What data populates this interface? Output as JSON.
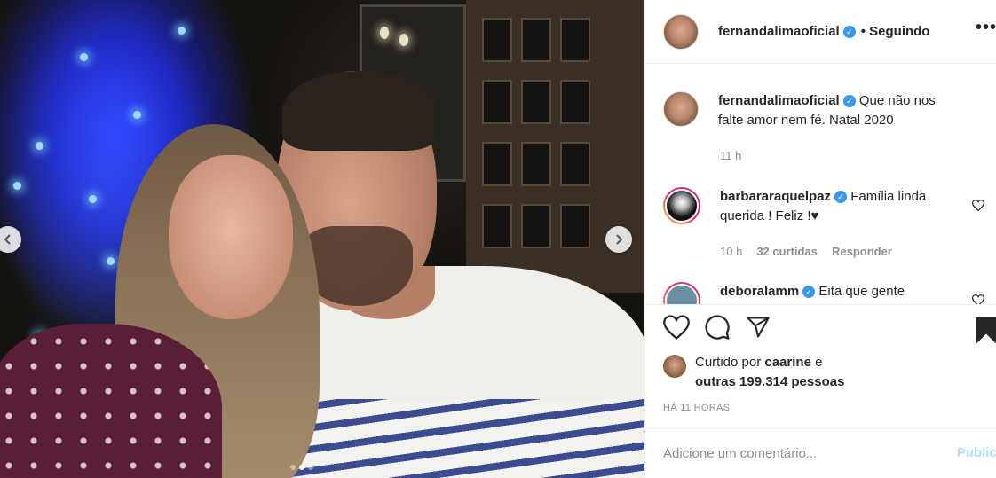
{
  "post": {
    "author": "fernandalimaoficial",
    "follow_status": "Seguindo",
    "more_icon": "•••",
    "caption": "Que não nos falte amor nem fé. Natal 2020",
    "caption_age": "11 h",
    "carousel": {
      "total_slides": 3,
      "active_slide": 2
    }
  },
  "comments": [
    {
      "username": "barbararaquelpaz",
      "text": "Família linda querida ! Feliz !♥",
      "age": "10 h",
      "likes": "32 curtidas",
      "reply": "Responder"
    },
    {
      "username": "deboralamm",
      "text": "Eita que gente"
    }
  ],
  "likes": {
    "prefix": "Curtido por",
    "first_user": "caarine",
    "connector": "e",
    "others": "outras 199.314 pessoas"
  },
  "posted_ago": "HÁ 11 HORAS",
  "comment_box": {
    "placeholder": "Adicione um comentário...",
    "submit_label": "Publicar"
  },
  "colors": {
    "verified": "#3897f0",
    "publish_disabled": "#b2dffc",
    "muted_text": "#8e8e8e"
  }
}
